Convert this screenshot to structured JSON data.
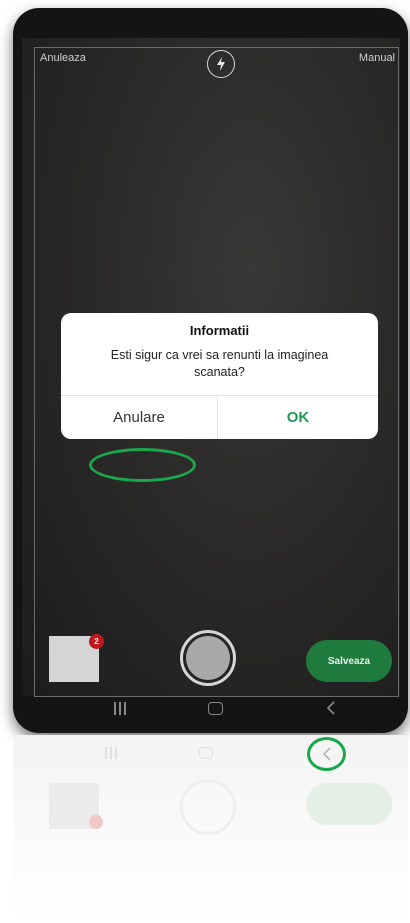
{
  "header": {
    "cancel_label": "Anuleaza",
    "manual_label": "Manual",
    "flash_icon": "flash-icon"
  },
  "dialog": {
    "title": "Informatii",
    "message": "Esti sigur ca vrei sa renunti la imaginea scanata?",
    "cancel_button": "Anulare",
    "ok_button": "OK"
  },
  "bottom_bar": {
    "thumbnail_badge_count": "2",
    "save_button": "Salveaza",
    "shutter_icon": "shutter-icon"
  },
  "colors": {
    "accent_green": "#1f7a3d",
    "ok_text_green": "#1f9a55",
    "badge_red": "#c4171d",
    "highlight_green": "#1aa64b"
  }
}
